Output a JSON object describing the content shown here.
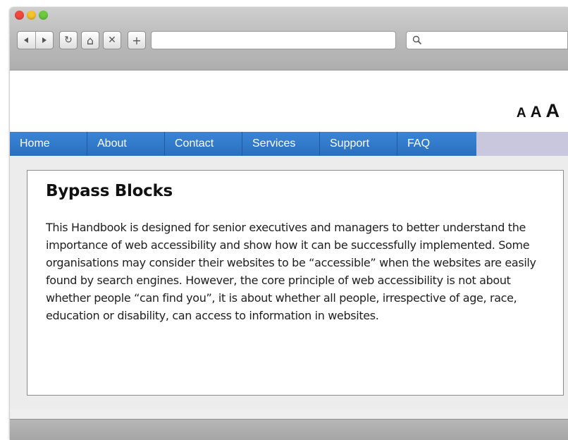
{
  "browser": {
    "traffic_lights": [
      "close",
      "minimize",
      "zoom"
    ],
    "back_icon": "back-arrow",
    "forward_icon": "forward-arrow",
    "reload_glyph": "↻",
    "home_glyph": "⌂",
    "stop_glyph": "✕",
    "new_tab_glyph": "+",
    "address_value": "",
    "search_value": "",
    "search_icon": "magnifier"
  },
  "text_size": {
    "small": "A",
    "medium": "A",
    "large": "A"
  },
  "menu": {
    "items": [
      {
        "label": "Home"
      },
      {
        "label": "About"
      },
      {
        "label": "Contact"
      },
      {
        "label": "Services"
      },
      {
        "label": "Support"
      },
      {
        "label": "FAQ"
      }
    ]
  },
  "main": {
    "title": "Bypass Blocks",
    "body": "This Handbook is designed for senior executives and managers to better understand the importance of web accessibility and show how it can be successfully implemented. Some organisations may consider their websites to be “accessible” when the websites are easily found by search engines. However, the core principle of web accessibility is not about whether people “can find you”, it is about whether all people, irrespective of age, race, education or disability, can access to information in websites."
  },
  "colors": {
    "menu_blue": "#2f78c8",
    "menu_strip": "#c9c7dd",
    "content_bg": "#ececec"
  }
}
